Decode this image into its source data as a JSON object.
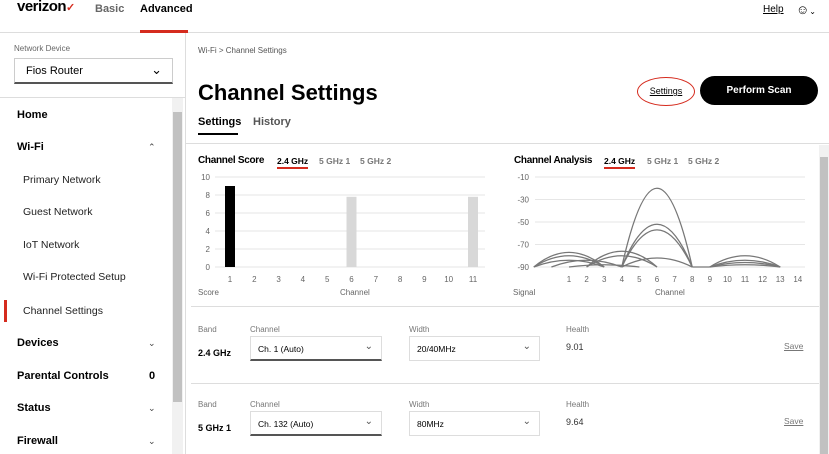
{
  "header": {
    "logo": "verizon",
    "logo_check": "✓",
    "nav": [
      "Basic",
      "Advanced"
    ],
    "help": "Help",
    "user_icon": "user-icon"
  },
  "sidebar": {
    "device_label": "Network Device",
    "device_value": "Fios Router",
    "items": [
      {
        "label": "Home"
      },
      {
        "label": "Wi-Fi"
      },
      {
        "label": "Primary Network"
      },
      {
        "label": "Guest Network"
      },
      {
        "label": "IoT Network"
      },
      {
        "label": "Wi-Fi Protected Setup"
      },
      {
        "label": "Channel Settings"
      },
      {
        "label": "Devices"
      },
      {
        "label": "Parental Controls",
        "badge": "0"
      },
      {
        "label": "Status"
      },
      {
        "label": "Firewall"
      }
    ]
  },
  "main": {
    "breadcrumb": "Wi-Fi  >  Channel Settings",
    "title": "Channel Settings",
    "settings_link": "Settings",
    "scan_button": "Perform Scan",
    "tabs": [
      "Settings",
      "History"
    ],
    "band_tabs": [
      "2.4 GHz",
      "5 GHz 1",
      "5 GHz 2"
    ],
    "rows": [
      {
        "band_label": "Band",
        "band": "2.4 GHz",
        "channel_label": "Channel",
        "channel": "Ch. 1 (Auto)",
        "width_label": "Width",
        "width": "20/40MHz",
        "health_label": "Health",
        "health": "9.01",
        "save": "Save"
      },
      {
        "band_label": "Band",
        "band": "5 GHz 1",
        "channel_label": "Channel",
        "channel": "Ch. 132 (Auto)",
        "width_label": "Width",
        "width": "80MHz",
        "health_label": "Health",
        "health": "9.64",
        "save": "Save"
      }
    ]
  },
  "chart_data": [
    {
      "type": "bar",
      "title": "Channel Score",
      "selected_band": "2.4 GHz",
      "categories": [
        "1",
        "2",
        "3",
        "4",
        "5",
        "6",
        "7",
        "8",
        "9",
        "10",
        "11"
      ],
      "values": [
        9,
        0,
        0,
        0,
        0,
        7.8,
        0,
        0,
        0,
        0,
        7.8
      ],
      "highlight": "1",
      "colors": {
        "selected": "#000000",
        "other": "#d8d8d8"
      },
      "ylabel": "Score",
      "xlabel": "Channel",
      "yticks": [
        0,
        2,
        4,
        6,
        8,
        10
      ],
      "ylim": [
        0,
        10
      ]
    },
    {
      "type": "line",
      "title": "Channel Analysis",
      "selected_band": "2.4 GHz",
      "ylabel": "Signal",
      "xlabel": "Channel",
      "yticks": [
        -10,
        -30,
        -50,
        -70,
        -90
      ],
      "ylim": [
        -90,
        -10
      ],
      "xticks": [
        1,
        2,
        3,
        4,
        5,
        6,
        7,
        8,
        9,
        10,
        11,
        12,
        13,
        14
      ],
      "series": [
        {
          "channel": 1,
          "peak": -77
        },
        {
          "channel": 1,
          "peak": -80
        },
        {
          "channel": 1,
          "peak": -84
        },
        {
          "channel": 2,
          "peak": -84
        },
        {
          "channel": 3,
          "peak": -88
        },
        {
          "channel": 4,
          "peak": -76
        },
        {
          "channel": 4,
          "peak": -80
        },
        {
          "channel": 6,
          "peak": -20
        },
        {
          "channel": 6,
          "peak": -52
        },
        {
          "channel": 6,
          "peak": -57
        },
        {
          "channel": 6,
          "peak": -82
        },
        {
          "channel": 11,
          "peak": -80
        },
        {
          "channel": 11,
          "peak": -84
        },
        {
          "channel": 11,
          "peak": -86
        },
        {
          "channel": 11,
          "peak": -88
        }
      ]
    }
  ]
}
